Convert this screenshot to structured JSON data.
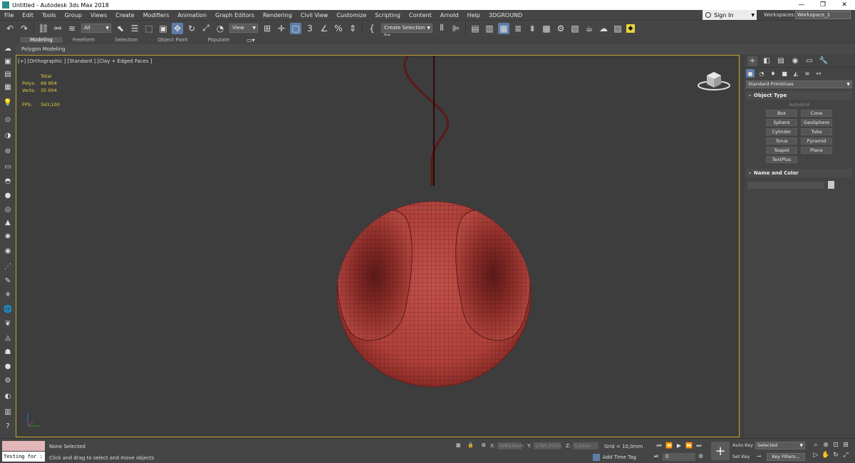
{
  "window": {
    "title": "Untitled - Autodesk 3ds Max 2018",
    "minimize": "—",
    "maximize": "❐",
    "close": "✕"
  },
  "menu": [
    "File",
    "Edit",
    "Tools",
    "Group",
    "Views",
    "Create",
    "Modifiers",
    "Animation",
    "Graph Editors",
    "Rendering",
    "Civil View",
    "Customize",
    "Scripting",
    "Content",
    "Arnold",
    "Help",
    "3DGROUND"
  ],
  "account": {
    "signin": "Sign In",
    "workspaces_label": "Workspaces:",
    "workspace": "Workspace_1"
  },
  "toolbar": {
    "selection_filter": "All",
    "ref_coord": "View",
    "selection_set": "Create Selection Se"
  },
  "ribbon": {
    "tabs": [
      "Modeling",
      "Freeform",
      "Selection",
      "Object Paint",
      "Populate"
    ],
    "subtitle": "Polygon Modeling"
  },
  "viewport": {
    "label": "[+] [Orthographic ] [Standard ] [Clay + Edged Faces ]",
    "stats": {
      "total": "Total",
      "polys_label": "Polys:",
      "polys": "69 904",
      "verts_label": "Verts:",
      "verts": "35 004",
      "fps_label": "FPS:",
      "fps": "343,100"
    }
  },
  "command_panel": {
    "dropdown": "Standard Primitives",
    "object_type": "Object Type",
    "autogrid": "AutoGrid",
    "primitives": [
      "Box",
      "Cone",
      "Sphere",
      "GeoSphere",
      "Cylinder",
      "Tube",
      "Torus",
      "Pyramid",
      "Teapot",
      "Plane",
      "TextPlus"
    ],
    "name_and_color": "Name and Color"
  },
  "status": {
    "maxscript": "Testing for :",
    "selection": "None Selected",
    "prompt": "Click and drag to select and move objects",
    "x_label": "X:",
    "x": "3994,9mm",
    "y_label": "Y:",
    "y": "1760,357m",
    "z_label": "Z:",
    "z": "0,0mm",
    "grid": "Grid = 10,0mm",
    "add_time_tag": "Add Time Tag",
    "frame": "0",
    "auto_key": "Auto Key",
    "set_key": "Set Key",
    "selected": "Selected",
    "key_filters": "Key Filters..."
  },
  "colors": {
    "accent": "#5e7ea8",
    "viewport_border": "#c8a42c",
    "model": "#b8403a",
    "stats": "#e9d23c"
  }
}
